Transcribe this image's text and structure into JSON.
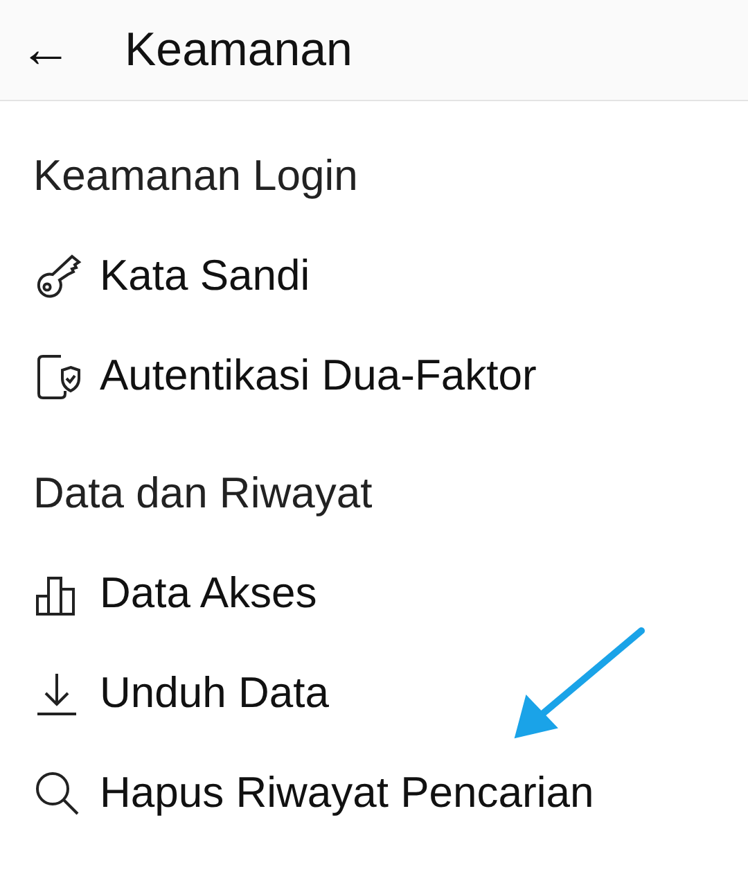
{
  "header": {
    "back_icon": "←",
    "title": "Keamanan"
  },
  "sections": [
    {
      "title": "Keamanan Login",
      "items": [
        {
          "label": "Kata Sandi"
        },
        {
          "label": "Autentikasi Dua-Faktor"
        }
      ]
    },
    {
      "title": "Data dan Riwayat",
      "items": [
        {
          "label": "Data Akses"
        },
        {
          "label": "Unduh Data"
        },
        {
          "label": "Hapus Riwayat Pencarian"
        }
      ]
    }
  ]
}
